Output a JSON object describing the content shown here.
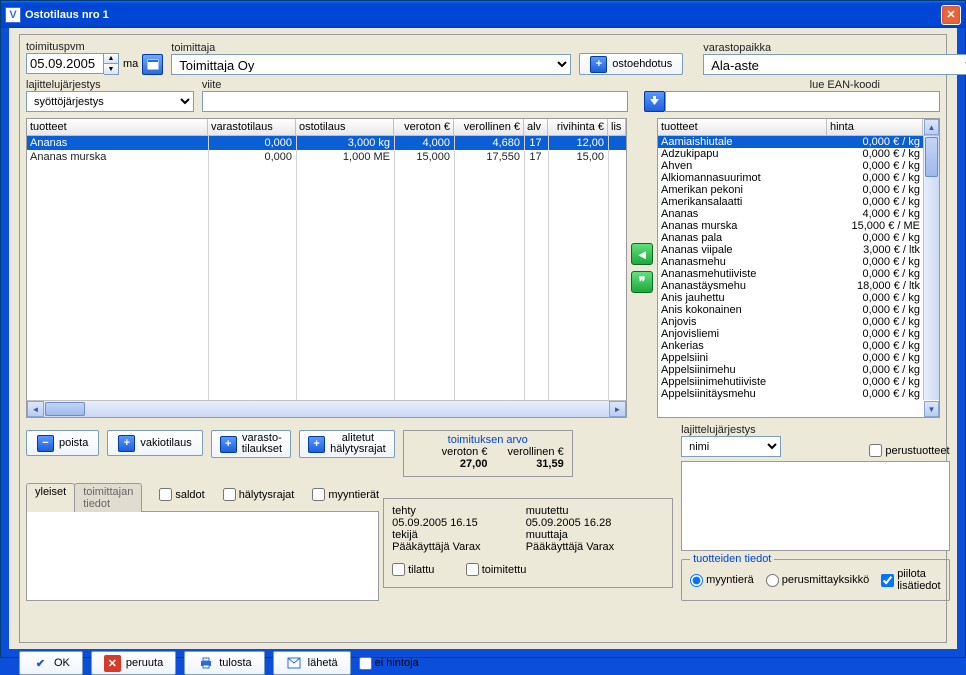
{
  "window_title": "Ostotilaus nro 1",
  "toimituspvm_label": "toimituspvm",
  "toimituspvm_value": "05.09.2005",
  "ma_label": "ma",
  "toimittaja_label": "toimittaja",
  "toimittaja_value": "Toimittaja Oy",
  "ostoehdotus_label": "ostoehdotus",
  "varastopaikka_label": "varastopaikka",
  "varastopaikka_value": "Ala-aste",
  "lajittelujarjestys_label": "lajittelujärjestys",
  "lajittelujarjestys_value": "syöttöjärjestys",
  "viite_label": "viite",
  "left_headers": [
    "tuotteet",
    "varastotilaus",
    "ostotilaus",
    "veroton €",
    "verollinen €",
    "alv",
    "rivihinta €",
    "lis"
  ],
  "left_rows": [
    {
      "cells": [
        "Ananas",
        "0,000",
        "3,000 kg",
        "4,000",
        "4,680",
        "17",
        "12,00",
        ""
      ],
      "selected": true
    },
    {
      "cells": [
        "Ananas murska",
        "0,000",
        "1,000 ME",
        "15,000",
        "17,550",
        "17",
        "15,00",
        ""
      ],
      "selected": false
    }
  ],
  "btn_poista": "poista",
  "btn_vakiotilaus": "vakiotilaus",
  "btn_varastotilaukset_line1": "varasto-",
  "btn_varastotilaukset_line2": "tilaukset",
  "btn_alitetut_line1": "alitetut",
  "btn_alitetut_line2": "hälytysrajat",
  "chk_saldot": "saldot",
  "chk_halytysrajat": "hälytysrajat",
  "chk_myyntierat": "myyntierät",
  "toimituksen_arvo": "toimituksen arvo",
  "veroton_label": "veroton €",
  "veroton_value": "27,00",
  "verollinen_label": "verollinen €",
  "verollinen_value": "31,59",
  "tab_yleiset": "yleiset",
  "tab_toimittajan": "toimittajan tiedot",
  "tehty_label": "tehty",
  "tehty_value": "05.09.2005  16.15",
  "muutettu_label": "muutettu",
  "muutettu_value": "05.09.2005  16.28",
  "tekija_label": "tekijä",
  "tekija_value": "Pääkäyttäjä Varax",
  "muuttaja_label": "muuttaja",
  "muuttaja_value": "Pääkäyttäjä Varax",
  "chk_tilattu": "tilattu",
  "chk_toimitettu": "toimitettu",
  "lue_ean": "lue EAN-koodi",
  "right_headers": [
    "tuotteet",
    "hinta"
  ],
  "products": [
    {
      "name": "Aamiaishiutale",
      "price": "0,000 € / kg",
      "sel": true
    },
    {
      "name": "Adzukipapu",
      "price": "0,000 € / kg"
    },
    {
      "name": "Ahven",
      "price": "0,000 € / kg"
    },
    {
      "name": "Alkiomannasuurimot",
      "price": "0,000 € / kg"
    },
    {
      "name": "Amerikan pekoni",
      "price": "0,000 € / kg"
    },
    {
      "name": "Amerikansalaatti",
      "price": "0,000 € / kg"
    },
    {
      "name": "Ananas",
      "price": "4,000 € / kg"
    },
    {
      "name": "Ananas murska",
      "price": "15,000 € / ME"
    },
    {
      "name": "Ananas pala",
      "price": "0,000 € / kg"
    },
    {
      "name": "Ananas viipale",
      "price": "3,000 € / ltk"
    },
    {
      "name": "Ananasmehu",
      "price": "0,000 € / kg"
    },
    {
      "name": "Ananasmehutiiviste",
      "price": "0,000 € / kg"
    },
    {
      "name": "Ananastäysmehu",
      "price": "18,000 € / ltk"
    },
    {
      "name": "Anis jauhettu",
      "price": "0,000 € / kg"
    },
    {
      "name": "Anis kokonainen",
      "price": "0,000 € / kg"
    },
    {
      "name": "Anjovis",
      "price": "0,000 € / kg"
    },
    {
      "name": "Anjovisliemi",
      "price": "0,000 € / kg"
    },
    {
      "name": "Ankerias",
      "price": "0,000 € / kg"
    },
    {
      "name": "Appelsiini",
      "price": "0,000 € / kg"
    },
    {
      "name": "Appelsiinimehu",
      "price": "0,000 € / kg"
    },
    {
      "name": "Appelsiinimehutiiviste",
      "price": "0,000 € / kg"
    },
    {
      "name": "Appelsiinitäysmehu",
      "price": "0,000 € / kg"
    }
  ],
  "chk_perustuotteet": "perustuotteet",
  "right_lajittelu_label": "lajittelujärjestys",
  "right_lajittelu_value": "nimi",
  "tuotteiden_tiedot": "tuotteiden tiedot",
  "radio_myyntiera": "myyntierä",
  "radio_perusmitta": "perusmittayksikkö",
  "chk_piilota": "piilota lisätiedot",
  "btn_ok": "OK",
  "btn_peruuta": "peruuta",
  "btn_tulosta": "tulosta",
  "btn_laheta": "lähetä",
  "chk_ei_hintoja": "ei hintoja"
}
